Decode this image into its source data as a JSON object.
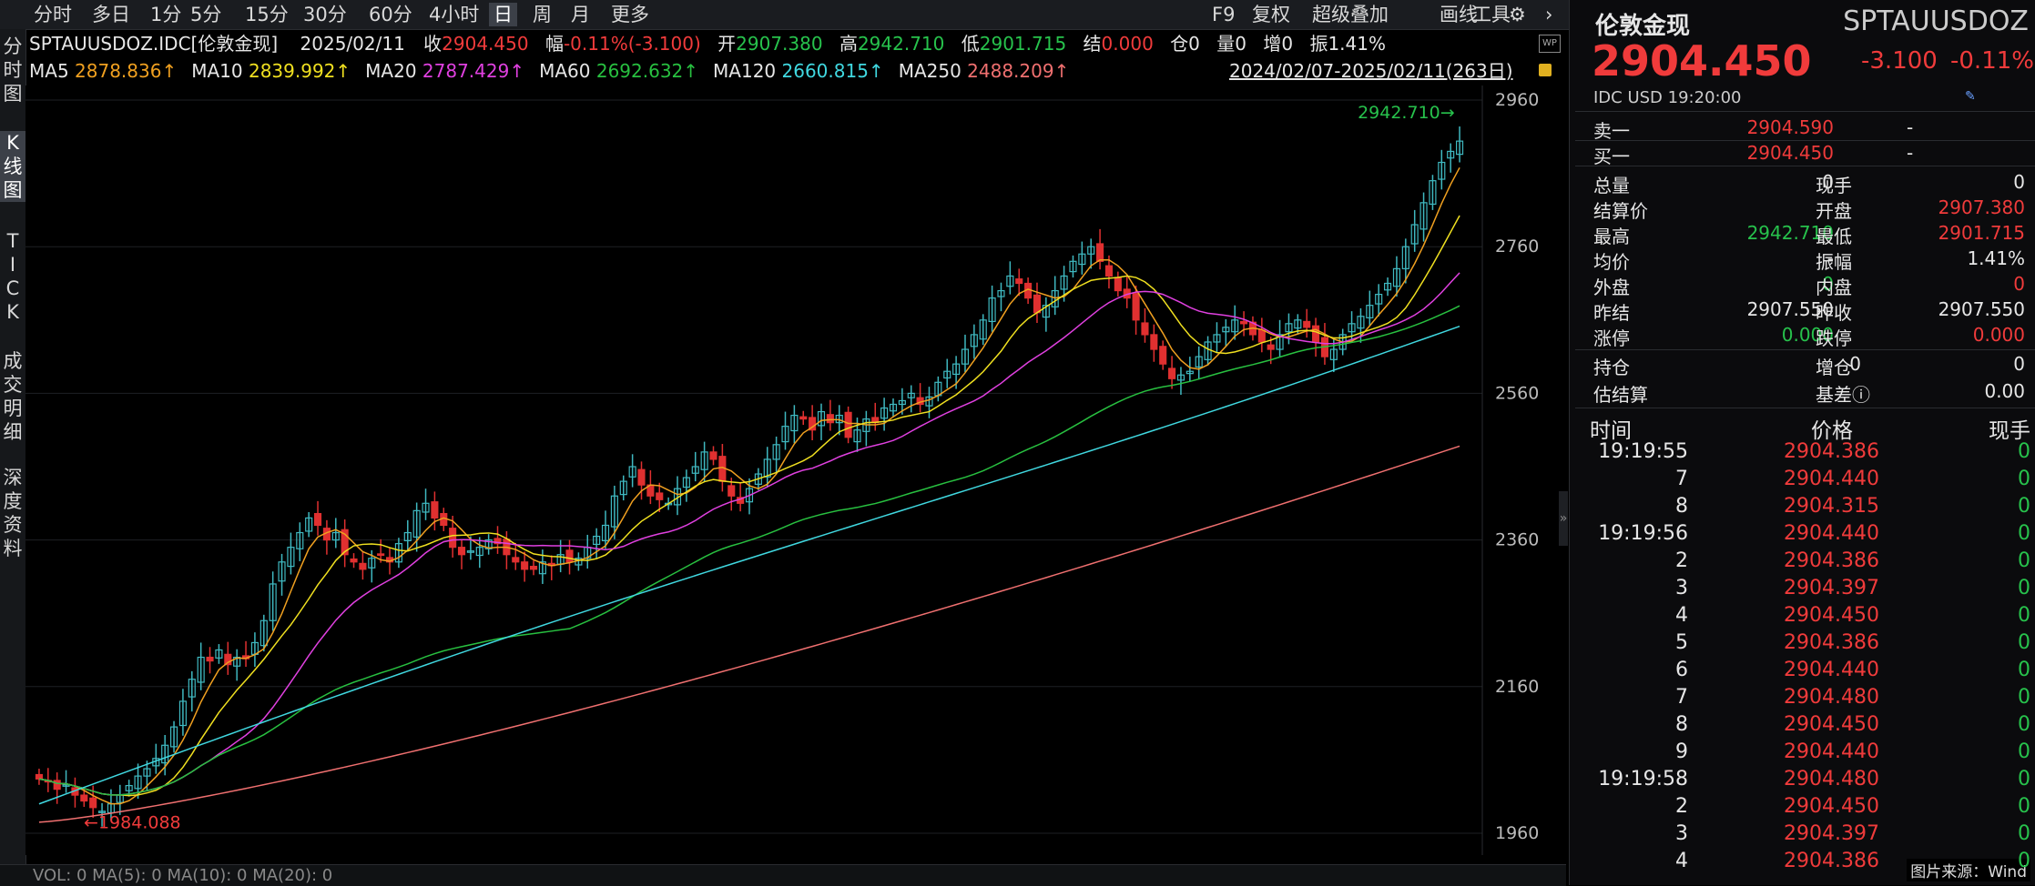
{
  "toolbar": {
    "periods": [
      "分时",
      "多日",
      "1分",
      "5分",
      "15分",
      "30分",
      "60分",
      "4小时",
      "日",
      "周",
      "月",
      "更多"
    ],
    "active": "日",
    "right": [
      "F9",
      "复权",
      "超级叠加",
      "画线",
      "工具"
    ]
  },
  "left_tabs": [
    {
      "label": "分\n时\n图",
      "active": false
    },
    {
      "label": "K\n线\n图",
      "active": true
    },
    {
      "label": "T\nI\nC\nK",
      "active": false
    },
    {
      "label": "成\n交\n明\n细",
      "active": false
    },
    {
      "label": "深\n度\n资\n料",
      "active": false
    }
  ],
  "quote_line": {
    "symbol": "SPTAUUSDOZ.IDC[伦敦金现]",
    "date": "2025/02/11",
    "close_label": "收",
    "close": "2904.450",
    "chg_label": "幅",
    "chg": "-0.11%(-3.100)",
    "open_label": "开",
    "open": "2907.380",
    "high_label": "高",
    "high": "2942.710",
    "low_label": "低",
    "low": "2901.715",
    "settle_label": "结",
    "settle": "0.000",
    "oi_label": "仓",
    "oi": "0",
    "vol_label": "量",
    "vol": "0",
    "inc_label": "增",
    "inc": "0",
    "amp_label": "振",
    "amp": "1.41%"
  },
  "ma_line": [
    {
      "label": "MA5",
      "value": "2878.836↑",
      "color": "#f0a020"
    },
    {
      "label": "MA10",
      "value": "2839.992↑",
      "color": "#f0e020"
    },
    {
      "label": "MA20",
      "value": "2787.429↑",
      "color": "#e040e0"
    },
    {
      "label": "MA60",
      "value": "2692.632↑",
      "color": "#28c040"
    },
    {
      "label": "MA120",
      "value": "2660.815↑",
      "color": "#40d8e0"
    },
    {
      "label": "MA250",
      "value": "2488.209↑",
      "color": "#f07070"
    }
  ],
  "range_label": "2024/02/07-2025/02/11(263日)",
  "chart_data": {
    "type": "candlestick",
    "y_ticks": [
      "2960",
      "2760",
      "2560",
      "2360",
      "2160",
      "1960"
    ],
    "ylim": [
      1960,
      2960
    ],
    "high_marker": "2942.710",
    "low_marker": "1984.088",
    "close_series": [
      2034,
      2030,
      2020,
      2026,
      2012,
      2004,
      1995,
      1990,
      2000,
      2012,
      2025,
      2038,
      2048,
      2062,
      2080,
      2105,
      2140,
      2170,
      2200,
      2195,
      2210,
      2190,
      2200,
      2198,
      2220,
      2250,
      2300,
      2330,
      2350,
      2370,
      2390,
      2380,
      2360,
      2370,
      2340,
      2330,
      2320,
      2335,
      2340,
      2330,
      2355,
      2370,
      2400,
      2410,
      2390,
      2380,
      2350,
      2340,
      2345,
      2350,
      2360,
      2355,
      2340,
      2330,
      2320,
      2320,
      2330,
      2325,
      2340,
      2330,
      2335,
      2350,
      2365,
      2380,
      2420,
      2440,
      2460,
      2435,
      2420,
      2415,
      2410,
      2430,
      2445,
      2460,
      2480,
      2470,
      2440,
      2420,
      2410,
      2430,
      2450,
      2470,
      2490,
      2515,
      2530,
      2525,
      2510,
      2535,
      2520,
      2530,
      2500,
      2510,
      2525,
      2520,
      2540,
      2545,
      2550,
      2560,
      2545,
      2555,
      2575,
      2590,
      2600,
      2620,
      2640,
      2660,
      2690,
      2700,
      2720,
      2710,
      2690,
      2670,
      2680,
      2700,
      2720,
      2740,
      2750,
      2760,
      2740,
      2720,
      2700,
      2690,
      2660,
      2640,
      2620,
      2600,
      2580,
      2585,
      2590,
      2610,
      2630,
      2640,
      2650,
      2660,
      2655,
      2640,
      2630,
      2620,
      2640,
      2655,
      2660,
      2650,
      2630,
      2610,
      2620,
      2640,
      2655,
      2665,
      2680,
      2695,
      2710,
      2730,
      2760,
      2790,
      2820,
      2850,
      2875,
      2890,
      2904
    ],
    "ma5": "#f0a020",
    "ma10": "#f0e020",
    "ma20": "#e040e0",
    "ma60": "#28c040",
    "ma120": "#40d8e0",
    "ma250": "#f07070"
  },
  "bottom_indicator": "VOL: 0  MA(5): 0  MA(10): 0  MA(20): 0",
  "panel": {
    "name": "伦敦金现",
    "code": "SPTAUUSDOZ",
    "price": "2904.450",
    "change": "-3.100",
    "change_pct": "-0.11%",
    "sub": "IDC  USD  19:20:00",
    "ask_label": "卖一",
    "ask": "2904.590",
    "ask_vol": "-",
    "bid_label": "买一",
    "bid": "2904.450",
    "bid_vol": "-",
    "stats_left": [
      {
        "label": "总量",
        "value": "0",
        "cls": "w"
      },
      {
        "label": "结算价",
        "value": "",
        "cls": "w"
      },
      {
        "label": "最高",
        "value": "2942.710",
        "cls": "g"
      },
      {
        "label": "均价",
        "value": "-",
        "cls": "w"
      },
      {
        "label": "外盘",
        "value": "0",
        "cls": "g"
      },
      {
        "label": "昨结",
        "value": "2907.550",
        "cls": "w"
      },
      {
        "label": "涨停",
        "value": "0.000",
        "cls": "g"
      }
    ],
    "stats_right": [
      {
        "label": "现手",
        "value": "0",
        "cls": "w"
      },
      {
        "label": "开盘",
        "value": "2907.380",
        "cls": "r"
      },
      {
        "label": "最低",
        "value": "2901.715",
        "cls": "r"
      },
      {
        "label": "振幅",
        "value": "1.41%",
        "cls": "w"
      },
      {
        "label": "内盘",
        "value": "0",
        "cls": "r"
      },
      {
        "label": "昨收",
        "value": "2907.550",
        "cls": "w"
      },
      {
        "label": "跌停",
        "value": "0.000",
        "cls": "r"
      }
    ],
    "oi_left": {
      "label": "持仓",
      "value": "0"
    },
    "oi_right": {
      "label": "增仓",
      "value": "0"
    },
    "est_left": {
      "label": "估结算",
      "value": ""
    },
    "est_right": {
      "label": "基差ⓘ",
      "value": "0.00"
    },
    "ticks_header": [
      "时间",
      "价格",
      "现手"
    ],
    "ticks": [
      [
        "19:19:55",
        "2904.386",
        "0"
      ],
      [
        "7",
        "2904.440",
        "0"
      ],
      [
        "8",
        "2904.315",
        "0"
      ],
      [
        "19:19:56",
        "2904.440",
        "0"
      ],
      [
        "2",
        "2904.386",
        "0"
      ],
      [
        "3",
        "2904.397",
        "0"
      ],
      [
        "4",
        "2904.450",
        "0"
      ],
      [
        "5",
        "2904.386",
        "0"
      ],
      [
        "6",
        "2904.440",
        "0"
      ],
      [
        "7",
        "2904.480",
        "0"
      ],
      [
        "8",
        "2904.450",
        "0"
      ],
      [
        "9",
        "2904.440",
        "0"
      ],
      [
        "19:19:58",
        "2904.480",
        "0"
      ],
      [
        "2",
        "2904.450",
        "0"
      ],
      [
        "3",
        "2904.397",
        "0"
      ],
      [
        "4",
        "2904.386",
        "0"
      ]
    ],
    "source": "图片来源：Wind"
  }
}
